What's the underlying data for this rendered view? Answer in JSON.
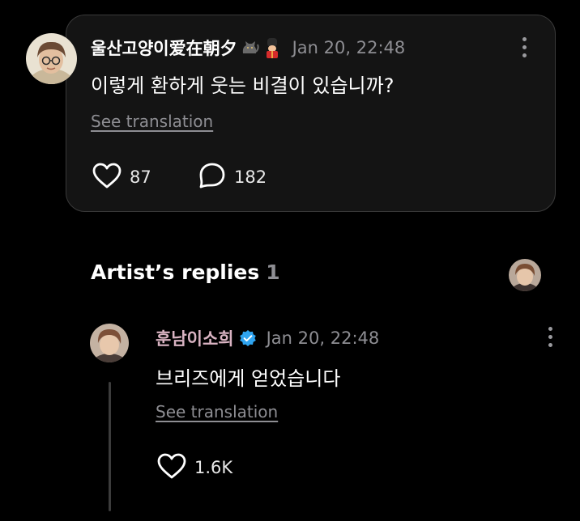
{
  "post": {
    "username": "울산고양이爱在朝夕",
    "emojis": [
      "cat-emoji",
      "guard-emoji"
    ],
    "timestamp": "Jan 20, 22:48",
    "text": "이렇게 환하게 웃는 비결이 있습니까?",
    "see_translation": "See translation",
    "like_count": "87",
    "comment_count": "182"
  },
  "artist_replies": {
    "title": "Artist’s replies",
    "count": "1"
  },
  "reply": {
    "username": "훈남이소희",
    "verified": true,
    "timestamp": "Jan 20, 22:48",
    "text": "브리즈에게 얻었습니다",
    "see_translation": "See translation",
    "like_count": "1.6K"
  },
  "colors": {
    "background": "#000000",
    "card": "#141414",
    "card_border": "#3a3a3a",
    "muted_text": "#8e8e93",
    "artist_name": "#d9b3c2",
    "verified_badge": "#2fa4f0"
  },
  "icons": {
    "like": "heart-outline-icon",
    "comment": "speech-bubble-icon",
    "more": "vertical-ellipsis-icon",
    "verified": "verified-badge-icon"
  }
}
